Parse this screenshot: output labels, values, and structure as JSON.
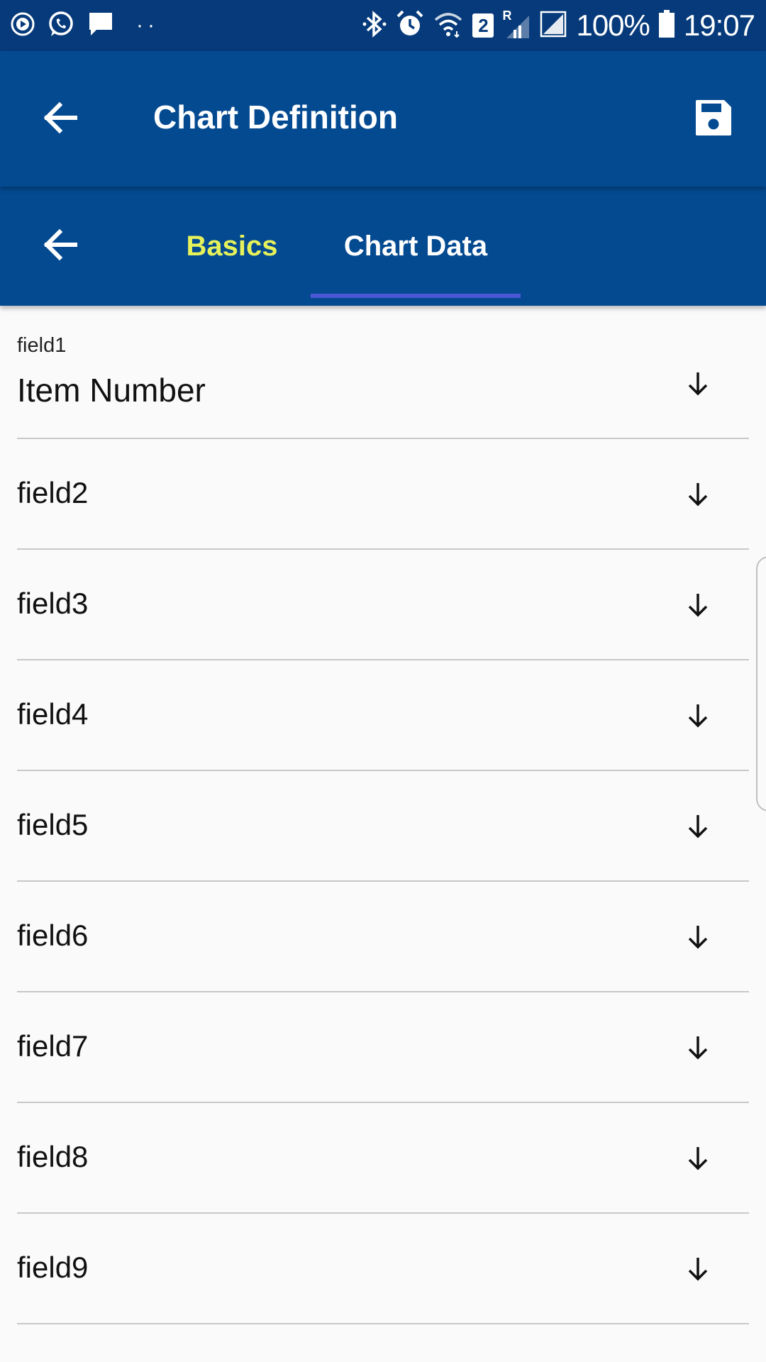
{
  "status_bar": {
    "battery": "100%",
    "time": "19:07",
    "sim_badge": "2",
    "roaming": "R",
    "icons": [
      "playback-icon",
      "whatsapp-icon",
      "message-icon",
      "bluetooth-icon",
      "alarm-icon",
      "wifi-icon",
      "signal-icon",
      "battery-icon"
    ]
  },
  "app_bar": {
    "title": "Chart Definition",
    "back_icon": "arrow-left-icon",
    "save_icon": "save-icon"
  },
  "tabs": {
    "items": [
      {
        "label": "Basics",
        "selected": false
      },
      {
        "label": "Chart Data",
        "selected": true
      }
    ],
    "colors": {
      "basics": "#e6f25a",
      "active": "#ffffff",
      "indicator": "#4c57d6"
    }
  },
  "fields": [
    {
      "label": "field1",
      "value": "Item Number"
    },
    {
      "label": "field2"
    },
    {
      "label": "field3"
    },
    {
      "label": "field4"
    },
    {
      "label": "field5"
    },
    {
      "label": "field6"
    },
    {
      "label": "field7"
    },
    {
      "label": "field8"
    },
    {
      "label": "field9"
    }
  ],
  "colors": {
    "status_bar": "#063a7a",
    "app_bar": "#044a91",
    "background": "#fafafa",
    "divider": "#c8c8c8"
  }
}
